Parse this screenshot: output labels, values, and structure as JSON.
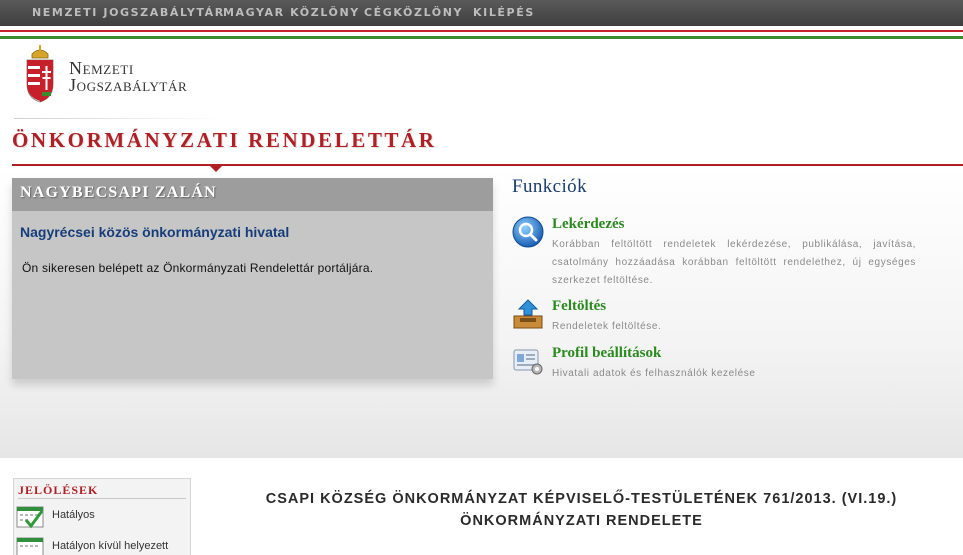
{
  "topnav": {
    "items": [
      "NEMZETI JOGSZABÁLYTÁR",
      "MAGYAR KÖZLÖNY",
      "CÉGKÖZLÖNY",
      "KILÉPÉS"
    ]
  },
  "logo": {
    "line1": "Nemzeti",
    "line2": "Jogszabálytár"
  },
  "section_title": "ÖNKORMÁNYZATI RENDELETTÁR",
  "panel": {
    "user_name": "NAGYBECSAPI ZALÁN",
    "org": "Nagyrécsei közös önkormányzati hivatal",
    "message": "Ön sikeresen belépett az Önkormányzati Rendelettár portáljára."
  },
  "functions": {
    "title": "Funkciók",
    "items": [
      {
        "name": "Lekérdezés",
        "desc": "Korábban feltöltött rendeletek lekérdezése, publikálása, javítása, csatolmány hozzáadása korábban feltöltött rendelethez, új egységes szerkezet feltöltése.",
        "icon": "magnifier-icon"
      },
      {
        "name": "Feltöltés",
        "desc": "Rendeletek feltöltése.",
        "icon": "upload-tray-icon"
      },
      {
        "name": "Profil beállítások",
        "desc": "Hivatali adatok és felhasználók kezelése",
        "icon": "profile-settings-icon"
      }
    ]
  },
  "sidebar": {
    "heading": "JELÖLÉSEK",
    "items": [
      {
        "label": "Hatályos",
        "icon": "calendar-check-icon"
      },
      {
        "label": "Hatályon kívül helyezett",
        "icon": "calendar-icon"
      }
    ]
  },
  "decree": {
    "line1": "CSAPI KÖZSÉG ÖNKORMÁNYZAT KÉPVISELŐ-TESTÜLETÉNEK 761/2013. (VI.19.)",
    "line2": "ÖNKORMÁNYZATI RENDELETE"
  },
  "colors": {
    "accent_red": "#b01f24",
    "flag_green": "#3a8a2e",
    "function_green": "#2a8a1e",
    "org_blue": "#163d7a",
    "nav_bg": "#474747"
  }
}
